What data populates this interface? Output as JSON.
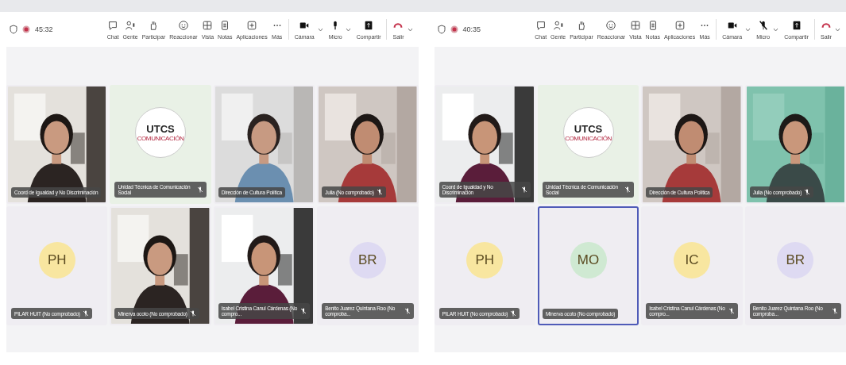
{
  "panels": [
    {
      "timer": "45:32",
      "mic_muted": false,
      "toolbar": [
        {
          "kind": "chat",
          "label": "Chat"
        },
        {
          "kind": "people",
          "label": "Gente"
        },
        {
          "kind": "hand",
          "label": "Participar"
        },
        {
          "kind": "react",
          "label": "Reaccionar"
        },
        {
          "kind": "view",
          "label": "Vista"
        },
        {
          "kind": "notes",
          "label": "Notas"
        },
        {
          "kind": "apps",
          "label": "Aplicaciones"
        },
        {
          "kind": "more",
          "label": "Más"
        },
        {
          "kind": "camera",
          "label": "Cámara"
        },
        {
          "kind": "mic",
          "label": "Micro"
        },
        {
          "kind": "share",
          "label": "Compartir"
        },
        {
          "kind": "leave",
          "label": "Salir"
        }
      ],
      "tiles": [
        {
          "kind": "video",
          "name": "Coord de Igualdad y No Discriminación",
          "muted": false,
          "speaking": false
        },
        {
          "kind": "logo",
          "logo": "UTCS",
          "logo_sub": "COMUNICACIÓN",
          "name": "Unidad Técnica de Comunicación Social",
          "muted": true,
          "speaking": false
        },
        {
          "kind": "video",
          "name": "Dirección de Cultura Política",
          "muted": false,
          "speaking": false
        },
        {
          "kind": "video",
          "name": "Julia (No comprobado)",
          "muted": true,
          "speaking": false
        },
        {
          "kind": "avatar",
          "initials": "PH",
          "color": "#f8e6a0",
          "name": "PILAR HUIT (No comprobado)",
          "muted": true,
          "speaking": false
        },
        {
          "kind": "video",
          "name": "Minerva ocoto (No comprobado)",
          "muted": true,
          "speaking": false
        },
        {
          "kind": "video",
          "name": "Isabel Cristina Canul Cárdenas (No compro...",
          "muted": true,
          "speaking": false
        },
        {
          "kind": "avatar",
          "initials": "BR",
          "color": "#dedaf2",
          "name": "Benito Juarez Quintana Roo (No comproba...",
          "muted": true,
          "speaking": false
        }
      ]
    },
    {
      "timer": "40:35",
      "mic_muted": true,
      "toolbar": [
        {
          "kind": "chat",
          "label": "Chat"
        },
        {
          "kind": "people",
          "label": "Gente"
        },
        {
          "kind": "hand",
          "label": "Participar"
        },
        {
          "kind": "react",
          "label": "Reaccionar"
        },
        {
          "kind": "view",
          "label": "Vista"
        },
        {
          "kind": "notes",
          "label": "Notas"
        },
        {
          "kind": "apps",
          "label": "Aplicaciones"
        },
        {
          "kind": "more",
          "label": "Más"
        },
        {
          "kind": "camera",
          "label": "Cámara"
        },
        {
          "kind": "mic",
          "label": "Micro"
        },
        {
          "kind": "share",
          "label": "Compartir"
        },
        {
          "kind": "leave",
          "label": "Salir"
        }
      ],
      "tiles": [
        {
          "kind": "video",
          "name": "Coord de Igualdad y No Discriminación",
          "muted": true,
          "speaking": false
        },
        {
          "kind": "logo",
          "logo": "UTCS",
          "logo_sub": "COMUNICACIÓN",
          "name": "Unidad Técnica de Comunicación Social",
          "muted": true,
          "speaking": false
        },
        {
          "kind": "video",
          "name": "Dirección de Cultura Política",
          "muted": false,
          "speaking": false
        },
        {
          "kind": "video",
          "name": "Julia (No comprobado)",
          "muted": true,
          "speaking": false
        },
        {
          "kind": "avatar",
          "initials": "PH",
          "color": "#f8e6a0",
          "name": "PILAR HUIT (No comprobado)",
          "muted": true,
          "speaking": false
        },
        {
          "kind": "avatar",
          "initials": "MO",
          "color": "#cfe9d2",
          "name": "Minerva ocoto (No comprobado)",
          "muted": false,
          "speaking": true
        },
        {
          "kind": "avatar",
          "initials": "IC",
          "color": "#f8e6a0",
          "name": "Isabel Cristina Canul Cárdenas (No compro...",
          "muted": true,
          "speaking": false
        },
        {
          "kind": "avatar",
          "initials": "BR",
          "color": "#dedaf2",
          "name": "Benito Juarez Quintana Roo (No comproba...",
          "muted": true,
          "speaking": false
        }
      ]
    }
  ]
}
